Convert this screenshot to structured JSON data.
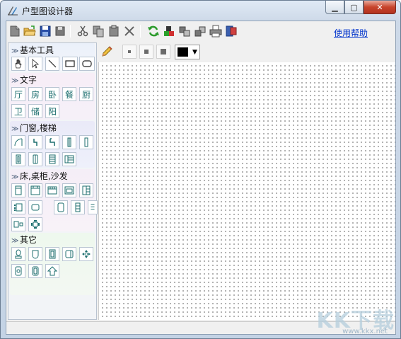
{
  "window": {
    "title": "户型图设计器",
    "min_label": "▁",
    "max_label": "▢",
    "close_label": "✕"
  },
  "toolbar": {
    "buttons": [
      "new-icon",
      "open-icon",
      "save-icon",
      "saveas-icon",
      "cut-icon",
      "copy-icon",
      "paste-icon",
      "delete-icon",
      "refresh-icon",
      "group-icon",
      "move-front-icon",
      "move-back-icon",
      "print-icon",
      "export-icon"
    ],
    "help_label": "使用帮助"
  },
  "sidebar": {
    "groups": [
      {
        "title": "基本工具",
        "items": [
          "hand-icon",
          "pointer-icon",
          "line-icon",
          "rect-icon",
          "rounded-rect-icon"
        ]
      },
      {
        "title": "文字",
        "items": [
          "厅",
          "房",
          "卧",
          "餐",
          "厨",
          "卫",
          "储",
          "阳"
        ]
      },
      {
        "title": "门窗,楼梯",
        "items": [
          "door-arc-icon",
          "door-single-icon",
          "door-double-icon",
          "window-thin-icon",
          "window-wide-icon",
          "window-frame-icon",
          "window-tall-icon",
          "stairs-icon",
          "stairs-half-icon"
        ]
      },
      {
        "title": "床,桌柜,沙发",
        "items": [
          "bed-single-icon",
          "bed-double-icon",
          "sofa-icon",
          "cabinet-icon",
          "wardrobe-icon",
          "desk-set-icon",
          "table-icon",
          "tub-icon",
          "locker-icon",
          "shelf-icon",
          "chair-table-icon",
          "dining-set-icon"
        ]
      },
      {
        "title": "其它",
        "items": [
          "toilet-icon",
          "basin-icon",
          "fridge-icon",
          "washer-icon",
          "plant-icon",
          "stove-icon",
          "oven-icon",
          "arrow-up-icon"
        ]
      }
    ]
  },
  "canvas_tools": {
    "pencil": "pencil-icon",
    "brush_sizes": [
      "brush-small-icon",
      "brush-medium-icon",
      "brush-large-icon"
    ],
    "color": "#000000",
    "color_dropdown": "▼"
  },
  "watermark": {
    "text": "KK下载",
    "url": "www.kkx.net"
  }
}
